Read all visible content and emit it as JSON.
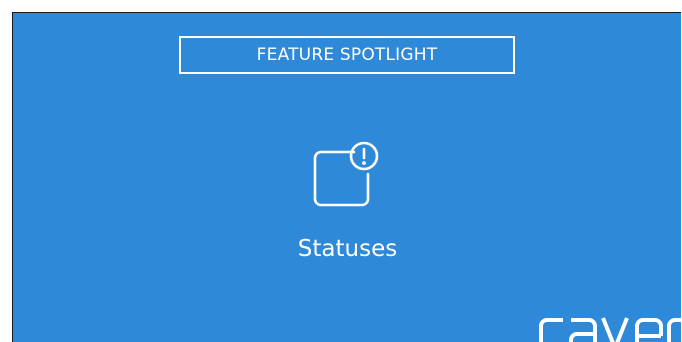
{
  "header": {
    "label": "FEATURE SPOTLIGHT"
  },
  "feature": {
    "icon": "status-alert-icon",
    "title": "Statuses"
  },
  "brand": {
    "name": "caven"
  },
  "colors": {
    "background": "#2e89d8",
    "foreground": "#ffffff"
  }
}
